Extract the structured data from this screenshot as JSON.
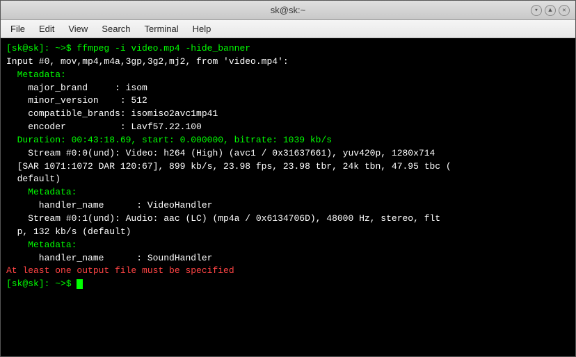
{
  "window": {
    "title": "sk@sk:~",
    "title_bar_buttons": [
      "▾",
      "▲",
      "✕"
    ]
  },
  "menu": {
    "items": [
      "File",
      "Edit",
      "View",
      "Search",
      "Terminal",
      "Help"
    ]
  },
  "terminal": {
    "lines": [
      {
        "type": "command",
        "text": "[sk@sk]: ~>$ ffmpeg -i video.mp4 -hide_banner"
      },
      {
        "type": "white",
        "text": "Input #0, mov,mp4,m4a,3gp,3g2,mj2, from 'video.mp4':"
      },
      {
        "type": "green",
        "text": "  Metadata:"
      },
      {
        "type": "white",
        "text": "    major_brand     : isom"
      },
      {
        "type": "white",
        "text": "    minor_version    : 512"
      },
      {
        "type": "white",
        "text": "    compatible_brands: isomiso2avc1mp41"
      },
      {
        "type": "white",
        "text": "    encoder          : Lavf57.22.100"
      },
      {
        "type": "green",
        "text": "  Duration: 00:43:18.69, start: 0.000000, bitrate: 1039 kb/s"
      },
      {
        "type": "white",
        "text": "    Stream #0:0(und): Video: h264 (High) (avc1 / 0x31637661), yuv420p, 1280x714"
      },
      {
        "type": "white",
        "text": "  [SAR 1071:1072 DAR 120:67], 899 kb/s, 23.98 fps, 23.98 tbr, 24k tbn, 47.95 tbc ("
      },
      {
        "type": "white",
        "text": "  default)"
      },
      {
        "type": "green",
        "text": "    Metadata:"
      },
      {
        "type": "white",
        "text": "      handler_name      : VideoHandler"
      },
      {
        "type": "white",
        "text": "    Stream #0:1(und): Audio: aac (LC) (mp4a / 0x6134706D), 48000 Hz, stereo, flt"
      },
      {
        "type": "white",
        "text": "  p, 132 kb/s (default)"
      },
      {
        "type": "green",
        "text": "    Metadata:"
      },
      {
        "type": "white",
        "text": "      handler_name      : SoundHandler"
      },
      {
        "type": "red",
        "text": "At least one output file must be specified"
      },
      {
        "type": "prompt",
        "text": "[sk@sk]: ~>$ "
      }
    ]
  }
}
